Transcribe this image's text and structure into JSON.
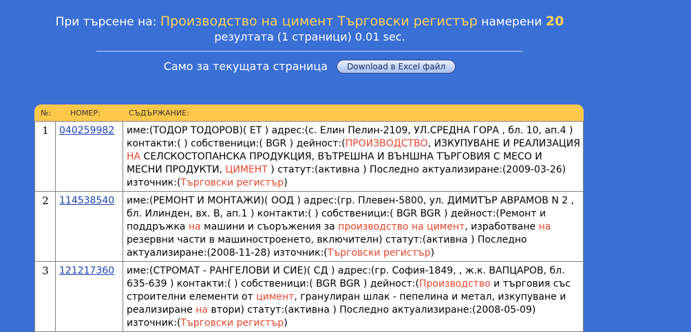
{
  "header": {
    "prefix": "При търсене на:",
    "query": "Производство на цимент Търговски регистър",
    "found_label": "намерени",
    "count": "20",
    "line2": "резултата (1 страници) 0.01 sec."
  },
  "excel": {
    "label": "Само за текущата страница",
    "button": "Download в Excel файл"
  },
  "table": {
    "headers": [
      "№:",
      "НОМЕР:",
      "СЪДЪРЖАНИЕ:"
    ],
    "rows": [
      {
        "num": "1",
        "id": "040259982",
        "parts": [
          {
            "t": "име:(ТОДОР ТОДОРОВ)( ЕТ ) адрес:(с. Елин Пелин-2109, УЛ.СРЕДНА ГОРА , бл. 10, ап.4 ) контакти:( ) собственици:( BGR ) дейност:("
          },
          {
            "t": "ПРОИЗВОДСТВО",
            "hl": true
          },
          {
            "t": ", ИЗКУПУВАНЕ И РЕАЛИЗАЦИЯ "
          },
          {
            "t": "НА",
            "hl": true
          },
          {
            "t": " СЕЛСКОСТОПАНСКА ПРОДУКЦИЯ, ВЪТРЕШНА И ВЪНШНА ТЪРГОВИЯ С МЕСО И МЕСНИ ПРОДУКТИ, "
          },
          {
            "t": "ЦИМЕНТ",
            "hl": true
          },
          {
            "t": " ) статут:(активна ) Последно актуализиране:(2009-03-26) източник:("
          },
          {
            "t": "Търговски регистър",
            "hl": true
          },
          {
            "t": ")"
          }
        ]
      },
      {
        "num": "2",
        "id": "114538540",
        "parts": [
          {
            "t": "име:(РЕМОНТ И МОНТАЖИ)( ООД ) адрес:(гр. Плевен-5800, ул. ДИМИТЪР АВРАМОВ N 2 , бл. Илинден, вх. В, ап.1 ) контакти:( ) собственици:( BGR BGR ) дейност:(Ремонт и поддръжка "
          },
          {
            "t": "на",
            "hl": true
          },
          {
            "t": " машини и съоръжения за "
          },
          {
            "t": "производство на цимент",
            "hl": true
          },
          {
            "t": ", изработване "
          },
          {
            "t": "на",
            "hl": true
          },
          {
            "t": " резервни части в машиностроенето, включителн) статут:(активна ) Последно актуализиране:(2008-11-28) източник:("
          },
          {
            "t": "Търговски регистър",
            "hl": true
          },
          {
            "t": ")"
          }
        ]
      },
      {
        "num": "3",
        "id": "121217360",
        "parts": [
          {
            "t": "име:(СТРОМАТ - РАНГЕЛОВИ И СИЕ)( СД ) адрес:(гр. София-1849, , ж.к. ВАПЦАРОВ, бл. 635-639 ) контакти:( ) собственици:( BGR BGR ) дейност:("
          },
          {
            "t": "Производство",
            "hl": true
          },
          {
            "t": " и търговия със строителни елементи от "
          },
          {
            "t": "цимент",
            "hl": true
          },
          {
            "t": ", гранулиран шлак - пепелина и метал, изкупуване и реализиране "
          },
          {
            "t": "на",
            "hl": true
          },
          {
            "t": " втори) статут:(активна ) Последно актуализиране:(2008-05-09) източник:("
          },
          {
            "t": "Търговски регистър",
            "hl": true
          },
          {
            "t": ")"
          }
        ]
      }
    ]
  },
  "colors": {
    "background": "#3a6fd6",
    "highlight": "#e8452c",
    "header_bar": "#ffc84a",
    "query_text": "#ffd257"
  }
}
